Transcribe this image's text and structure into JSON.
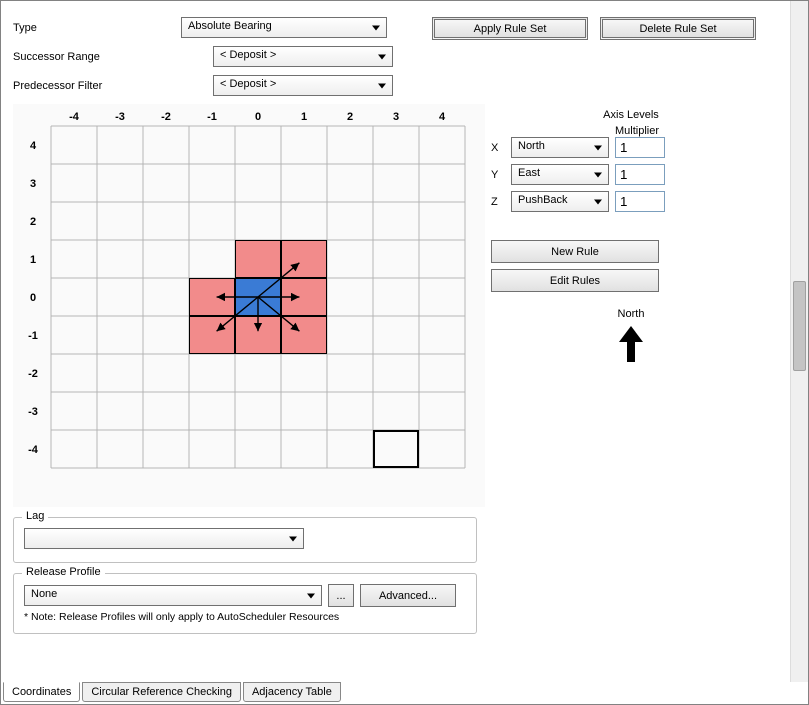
{
  "labels": {
    "type": "Type",
    "successor_range": "Successor Range",
    "predecessor_filter": "Predecessor Filter",
    "lag": "Lag",
    "release_profile": "Release Profile",
    "axis_levels": "Axis Levels",
    "multiplier": "Multiplier",
    "x": "X",
    "y": "Y",
    "z": "Z",
    "north": "North"
  },
  "combos": {
    "type": "Absolute Bearing",
    "successor_range": "< Deposit >",
    "predecessor_filter": "< Deposit >",
    "lag": "",
    "release_profile": "None",
    "axis_x": "North",
    "axis_y": "East",
    "axis_z": "PushBack"
  },
  "inputs": {
    "mult_x": "1",
    "mult_y": "1",
    "mult_z": "1"
  },
  "buttons": {
    "apply_rule_set": "Apply Rule Set",
    "delete_rule_set": "Delete Rule Set",
    "new_rule": "New Rule",
    "edit_rules": "Edit Rules",
    "ellipsis": "...",
    "advanced": "Advanced..."
  },
  "note": "* Note: Release Profiles will only apply to AutoScheduler Resources",
  "tabs": {
    "coordinates": "Coordinates",
    "circular": "Circular Reference Checking",
    "adjacency": "Adjacency Table"
  },
  "grid": {
    "axis": [
      "-4",
      "-3",
      "-2",
      "-1",
      "0",
      "1",
      "2",
      "3",
      "4"
    ]
  },
  "chart_data": {
    "type": "heatmap",
    "title": "",
    "xlabel": "",
    "ylabel": "",
    "x_range": [
      -4,
      4
    ],
    "y_range": [
      -4,
      4
    ],
    "center_cell": {
      "x": 0,
      "y": 0,
      "color": "#3a7bd5"
    },
    "highlighted_cells": [
      {
        "x": 0,
        "y": 1
      },
      {
        "x": 1,
        "y": 1
      },
      {
        "x": -1,
        "y": 0
      },
      {
        "x": 1,
        "y": 0
      },
      {
        "x": -1,
        "y": -1
      },
      {
        "x": 0,
        "y": -1
      },
      {
        "x": 1,
        "y": -1
      }
    ],
    "highlight_color": "#f28b8b",
    "outlined_cell": {
      "x": 3,
      "y": -4
    },
    "arrows_from_center": [
      "W",
      "E",
      "NE",
      "SW",
      "S",
      "SE"
    ]
  }
}
